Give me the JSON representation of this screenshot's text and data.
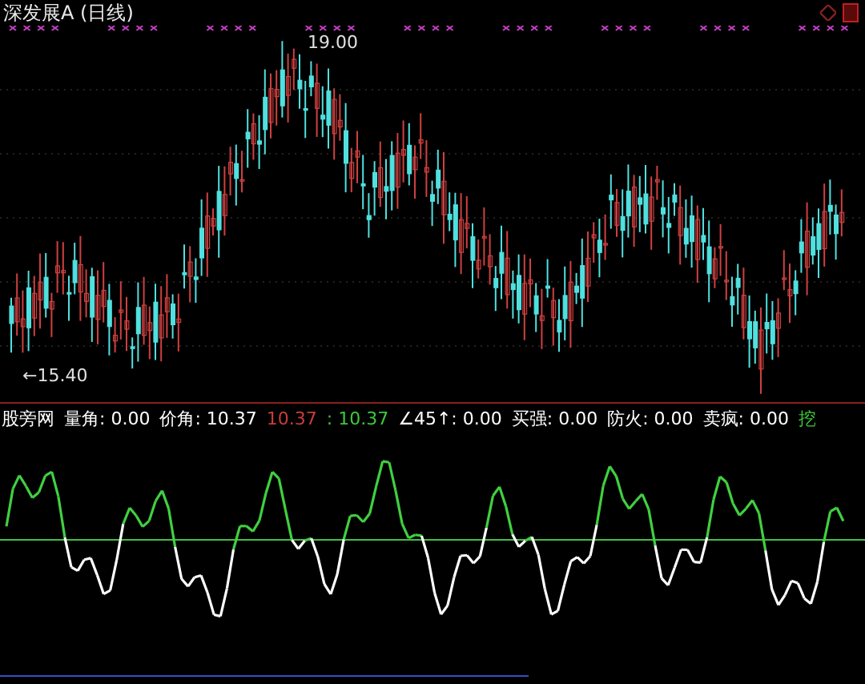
{
  "chart_title": "深发展A (日线)",
  "price_panel": {
    "high_label": "19.00",
    "low_label": "←15.40"
  },
  "indicator_values": [
    {
      "text": "股旁网",
      "color": "#ffffff"
    },
    {
      "text": "量角: 0.00",
      "color": "#ffffff"
    },
    {
      "text": "价角: 10.37",
      "color": "#ffffff"
    },
    {
      "text": "10.37",
      "color": "#c83c3c"
    },
    {
      "text": ": 10.37",
      "color": "#3cc83c"
    },
    {
      "text": "∠45↑: 0.00",
      "color": "#ffffff"
    },
    {
      "text": "买强: 0.00",
      "color": "#ffffff"
    },
    {
      "text": "防火: 0.00",
      "color": "#ffffff"
    },
    {
      "text": "卖疯: 0.00",
      "color": "#ffffff"
    },
    {
      "text": "挖",
      "color": "#3cc83c"
    }
  ]
}
